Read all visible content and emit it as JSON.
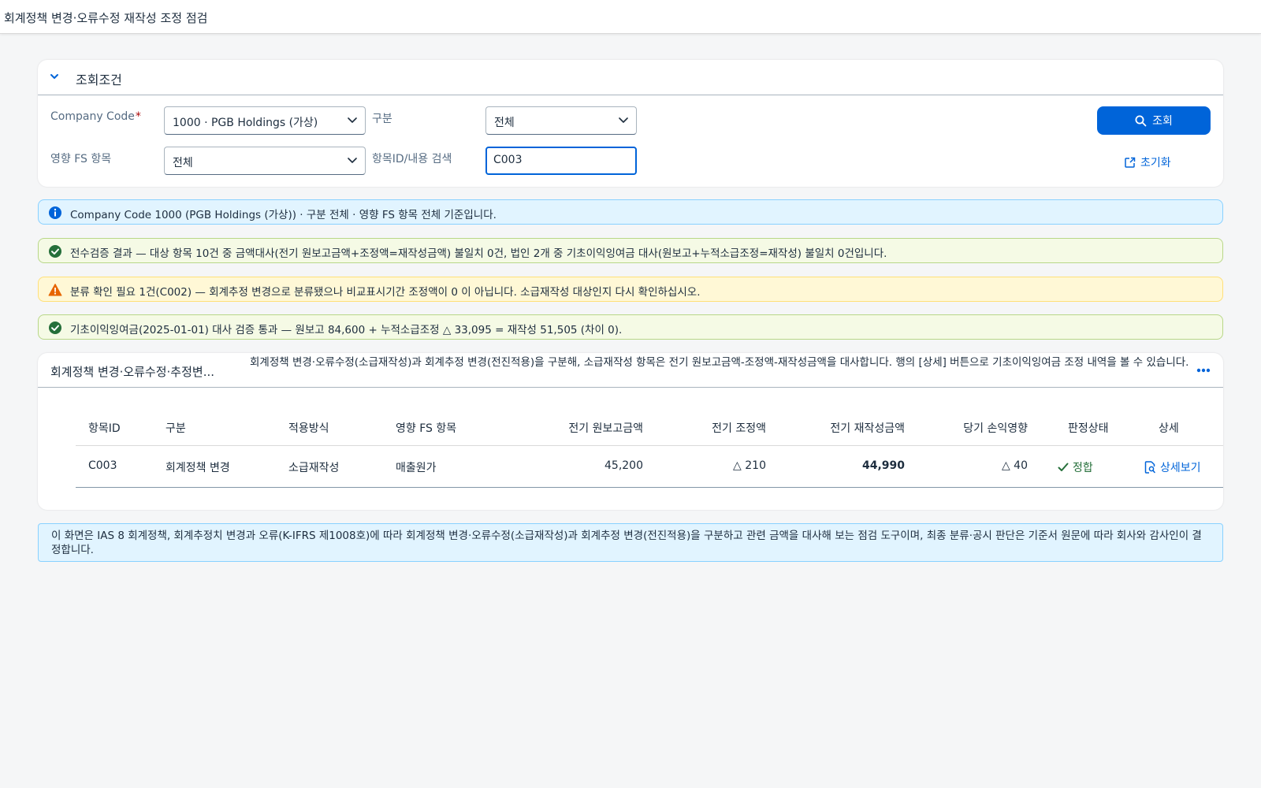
{
  "app": {
    "title": "회계정책 변경·오류수정 재작성 조정 점검"
  },
  "filter": {
    "header": "조회조건",
    "company_code_label": "Company Code",
    "company_code_required": "*",
    "company_code_value": "1000 · PGB Holdings (가상)",
    "category_label": "구분",
    "category_value": "전체",
    "fs_item_label": "영향 FS 항목",
    "fs_item_value": "전체",
    "search_label": "항목ID/내용 검색",
    "search_value": "C003",
    "search_button": "조회",
    "reset_button": "초기화"
  },
  "messages": [
    {
      "type": "info",
      "icon": "info-icon",
      "text": "Company Code 1000 (PGB Holdings (가상)) · 구분 전체 · 영향 FS 항목 전체 기준입니다."
    },
    {
      "type": "success",
      "icon": "success-icon",
      "text": "전수검증 결과 — 대상 항목 10건 중 금액대사(전기 원보고금액+조정액=재작성금액) 불일치 0건, 법인 2개 중 기초이익잉여금 대사(원보고+누적소급조정=재작성) 불일치 0건입니다."
    },
    {
      "type": "warning",
      "icon": "warning-icon",
      "text": "분류 확인 필요 1건(C002) — 회계추정 변경으로 분류됐으나 비교표시기간 조정액이 0 이 아닙니다. 소급재작성 대상인지 다시 확인하십시오."
    },
    {
      "type": "success",
      "icon": "success-icon",
      "text": "기초이익잉여금(2025-01-01) 대사 검증 통과 — 원보고 84,600 + 누적소급조정 △ 33,095 = 재작성 51,505 (차이 0)."
    }
  ],
  "table": {
    "title": "회계정책 변경·오류수정·추정변...",
    "description": "회계정책 변경·오류수정(소급재작성)과 회계추정 변경(전진적용)을 구분해, 소급재작성 항목은 전기 원보고금액-조정액-재작성금액을 대사합니다. 행의 [상세] 버튼으로 기초이익잉여금 조정 내역을 볼 수 있습니다.",
    "columns": [
      "항목ID",
      "구분",
      "적용방식",
      "영향 FS 항목",
      "전기 원보고금액",
      "전기 조정액",
      "전기 재작성금액",
      "당기 손익영향",
      "판정상태",
      "상세"
    ],
    "rows": [
      {
        "id": "C003",
        "category": "회계정책 변경",
        "method": "소급재작성",
        "fs_item": "매출원가",
        "original": "45,200",
        "adjustment": "△ 210",
        "restated": "44,990",
        "pl_impact": "△ 40",
        "status": "정합",
        "detail": "상세보기"
      }
    ]
  },
  "note": {
    "text": "이 화면은 IAS 8 회계정책, 회계추정치 변경과 오류(K-IFRS 제1008호)에 따라 회계정책 변경·오류수정(소급재작성)과 회계추정 변경(전진적용)을 구분하고 관련 금액을 대사해 보는 점검 도구이며, 최종 분류·공시 판단은 기준서 원문에 따라 회사와 감사인이 결정합니다."
  },
  "colors": {
    "accent": "#0064d9",
    "success": "#256f3a",
    "warning": "#e76500",
    "info_bg": "#e1f4ff",
    "success_bg": "#f5fae5",
    "warning_bg": "#fff8d6"
  }
}
